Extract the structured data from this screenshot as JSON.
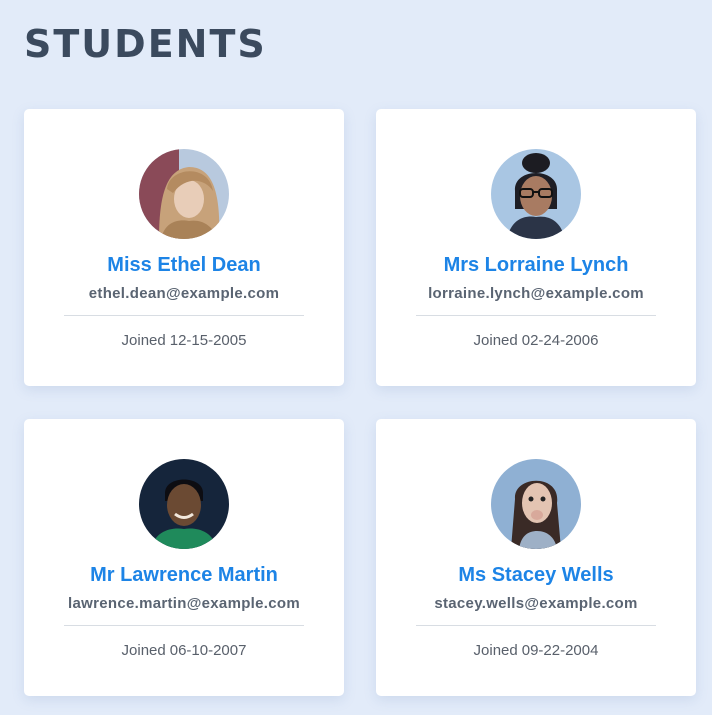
{
  "page": {
    "title": "STUDENTS"
  },
  "students": [
    {
      "name": "Miss Ethel Dean",
      "email": "ethel.dean@example.com",
      "joined_label": "Joined",
      "joined_date": "12-15-2005"
    },
    {
      "name": "Mrs Lorraine Lynch",
      "email": "lorraine.lynch@example.com",
      "joined_label": "Joined",
      "joined_date": "02-24-2006"
    },
    {
      "name": "Mr Lawrence Martin",
      "email": "lawrence.martin@example.com",
      "joined_label": "Joined",
      "joined_date": "06-10-2007"
    },
    {
      "name": "Ms Stacey Wells",
      "email": "stacey.wells@example.com",
      "joined_label": "Joined",
      "joined_date": "09-22-2004"
    }
  ],
  "colors": {
    "background": "#e2ebf9",
    "card": "#ffffff",
    "accent": "#1d84e6",
    "title": "#3b4a5e"
  }
}
